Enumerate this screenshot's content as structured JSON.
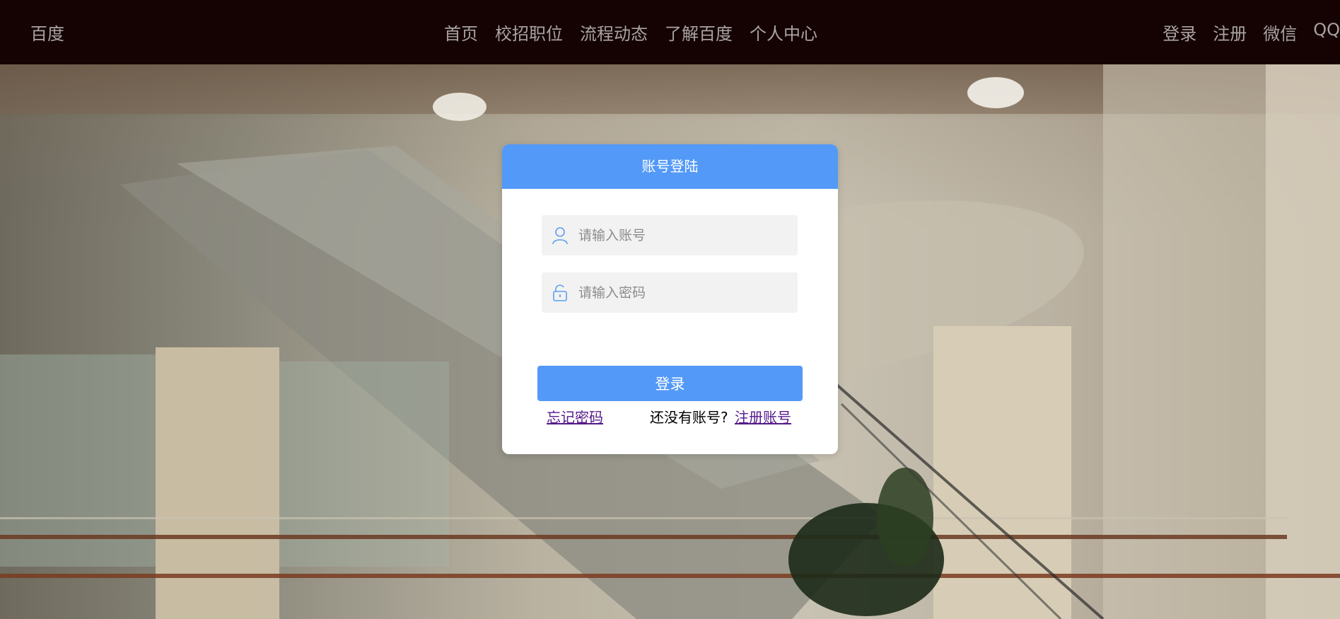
{
  "header": {
    "brand": "百度",
    "nav": [
      "首页",
      "校招职位",
      "流程动态",
      "了解百度",
      "个人中心"
    ],
    "user_links": [
      "登录",
      "注册",
      "微信",
      "QQ"
    ]
  },
  "login": {
    "title": "账号登陆",
    "username": {
      "placeholder": "请输入账号",
      "value": "",
      "icon": "user-icon"
    },
    "password": {
      "placeholder": "请输入密码",
      "value": "",
      "icon": "lock-icon"
    },
    "submit_label": "登录",
    "forgot_label": "忘记密码",
    "no_account_text": "还没有账号?",
    "register_label": "注册账号"
  },
  "colors": {
    "topbar": "#150303",
    "accent": "#5399f7",
    "link_visited": "#551a8b",
    "field_bg": "#f2f2f2"
  }
}
